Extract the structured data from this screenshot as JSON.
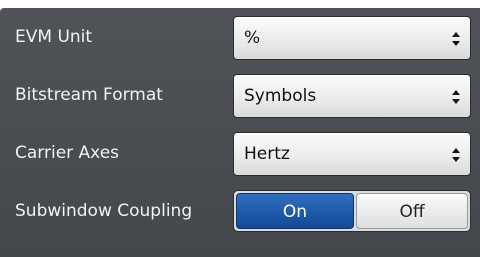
{
  "settings": [
    {
      "label": "EVM Unit",
      "value": "%"
    },
    {
      "label": "Bitstream Format",
      "value": "Symbols"
    },
    {
      "label": "Carrier Axes",
      "value": "Hertz"
    }
  ],
  "subwindow_coupling": {
    "label": "Subwindow Coupling",
    "options": [
      "On",
      "Off"
    ],
    "selected": "On"
  },
  "icons": {
    "dropdown": "up-down-arrows-icon"
  },
  "colors": {
    "panel_bg": "#4a4d52",
    "selected_toggle": "#1f5cad",
    "label_text": "#f2f2f2"
  }
}
